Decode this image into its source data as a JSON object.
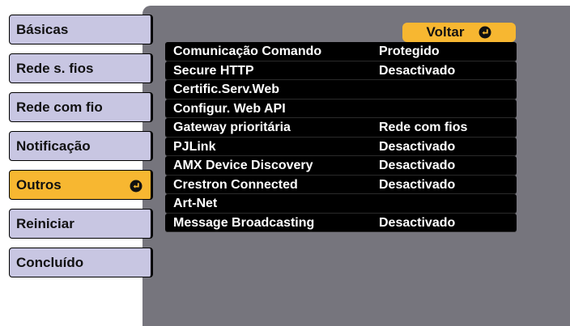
{
  "sidebar": {
    "items": [
      {
        "label": "Básicas",
        "selected": false
      },
      {
        "label": "Rede s. fios",
        "selected": false
      },
      {
        "label": "Rede com fio",
        "selected": false
      },
      {
        "label": "Notificação",
        "selected": false
      },
      {
        "label": "Outros",
        "selected": true
      },
      {
        "label": "Reiniciar",
        "selected": false
      },
      {
        "label": "Concluído",
        "selected": false
      }
    ]
  },
  "main": {
    "back_label": "Voltar",
    "rows": [
      {
        "label": "Comunicação Comando",
        "value": "Protegido"
      },
      {
        "label": "Secure HTTP",
        "value": "Desactivado"
      },
      {
        "label": "Certific.Serv.Web",
        "value": ""
      },
      {
        "label": "Configur. Web API",
        "value": ""
      },
      {
        "label": "Gateway prioritária",
        "value": "Rede com fios"
      },
      {
        "label": "PJLink",
        "value": "Desactivado"
      },
      {
        "label": "AMX Device Discovery",
        "value": "Desactivado"
      },
      {
        "label": "Crestron Connected",
        "value": "Desactivado"
      },
      {
        "label": "Art-Net",
        "value": ""
      },
      {
        "label": "Message Broadcasting",
        "value": "Desactivado"
      }
    ]
  },
  "colors": {
    "menu_bg": "#c8c6e2",
    "selected_bg": "#f7b731",
    "panel_bg": "#76757d",
    "row_bg": "#000000"
  },
  "icons": {
    "enter": "enter-return-icon"
  }
}
